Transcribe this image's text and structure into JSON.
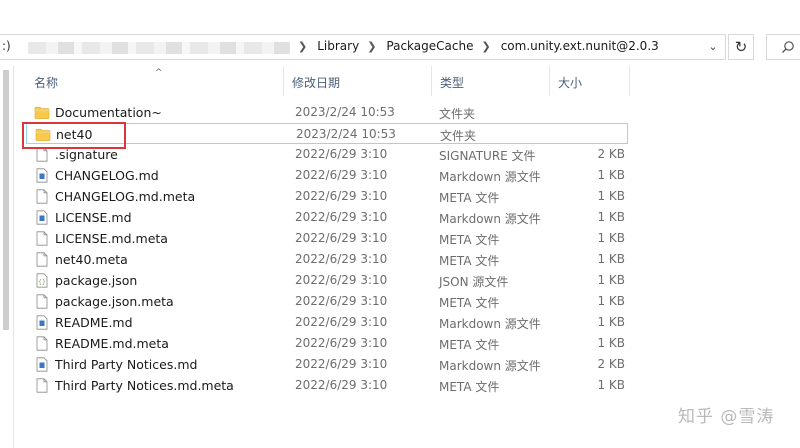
{
  "address_bar": {
    "drive_fragment": ":)",
    "crumbs": [
      "Library",
      "PackageCache",
      "com.unity.ext.nunit@2.0.3"
    ]
  },
  "columns": {
    "name": "名称",
    "date": "修改日期",
    "type": "类型",
    "size": "大小"
  },
  "files": [
    {
      "name": "Documentation~",
      "date": "2023/2/24 10:53",
      "type": "文件夹",
      "size": "",
      "icon": "folder-icon"
    },
    {
      "name": "net40",
      "date": "2023/2/24 10:53",
      "type": "文件夹",
      "size": "",
      "icon": "folder-icon"
    },
    {
      "name": ".signature",
      "date": "2022/6/29 3:10",
      "type": "SIGNATURE 文件",
      "size": "2 KB",
      "icon": "file-icon"
    },
    {
      "name": "CHANGELOG.md",
      "date": "2022/6/29 3:10",
      "type": "Markdown 源文件",
      "size": "1 KB",
      "icon": "markdown-file-icon"
    },
    {
      "name": "CHANGELOG.md.meta",
      "date": "2022/6/29 3:10",
      "type": "META 文件",
      "size": "1 KB",
      "icon": "file-icon"
    },
    {
      "name": "LICENSE.md",
      "date": "2022/6/29 3:10",
      "type": "Markdown 源文件",
      "size": "1 KB",
      "icon": "markdown-file-icon"
    },
    {
      "name": "LICENSE.md.meta",
      "date": "2022/6/29 3:10",
      "type": "META 文件",
      "size": "1 KB",
      "icon": "file-icon"
    },
    {
      "name": "net40.meta",
      "date": "2022/6/29 3:10",
      "type": "META 文件",
      "size": "1 KB",
      "icon": "file-icon"
    },
    {
      "name": "package.json",
      "date": "2022/6/29 3:10",
      "type": "JSON 源文件",
      "size": "1 KB",
      "icon": "json-file-icon"
    },
    {
      "name": "package.json.meta",
      "date": "2022/6/29 3:10",
      "type": "META 文件",
      "size": "1 KB",
      "icon": "file-icon"
    },
    {
      "name": "README.md",
      "date": "2022/6/29 3:10",
      "type": "Markdown 源文件",
      "size": "1 KB",
      "icon": "markdown-file-icon"
    },
    {
      "name": "README.md.meta",
      "date": "2022/6/29 3:10",
      "type": "META 文件",
      "size": "1 KB",
      "icon": "file-icon"
    },
    {
      "name": "Third Party Notices.md",
      "date": "2022/6/29 3:10",
      "type": "Markdown 源文件",
      "size": "2 KB",
      "icon": "markdown-file-icon"
    },
    {
      "name": "Third Party Notices.md.meta",
      "date": "2022/6/29 3:10",
      "type": "META 文件",
      "size": "1 KB",
      "icon": "file-icon"
    }
  ],
  "selected_item": "net40",
  "watermark": "知乎 @雪涛",
  "colors": {
    "folder": "#f8c94a",
    "selection_border": "#99d1ff",
    "annotation": "#d9363e",
    "header_text": "#4c607a"
  }
}
